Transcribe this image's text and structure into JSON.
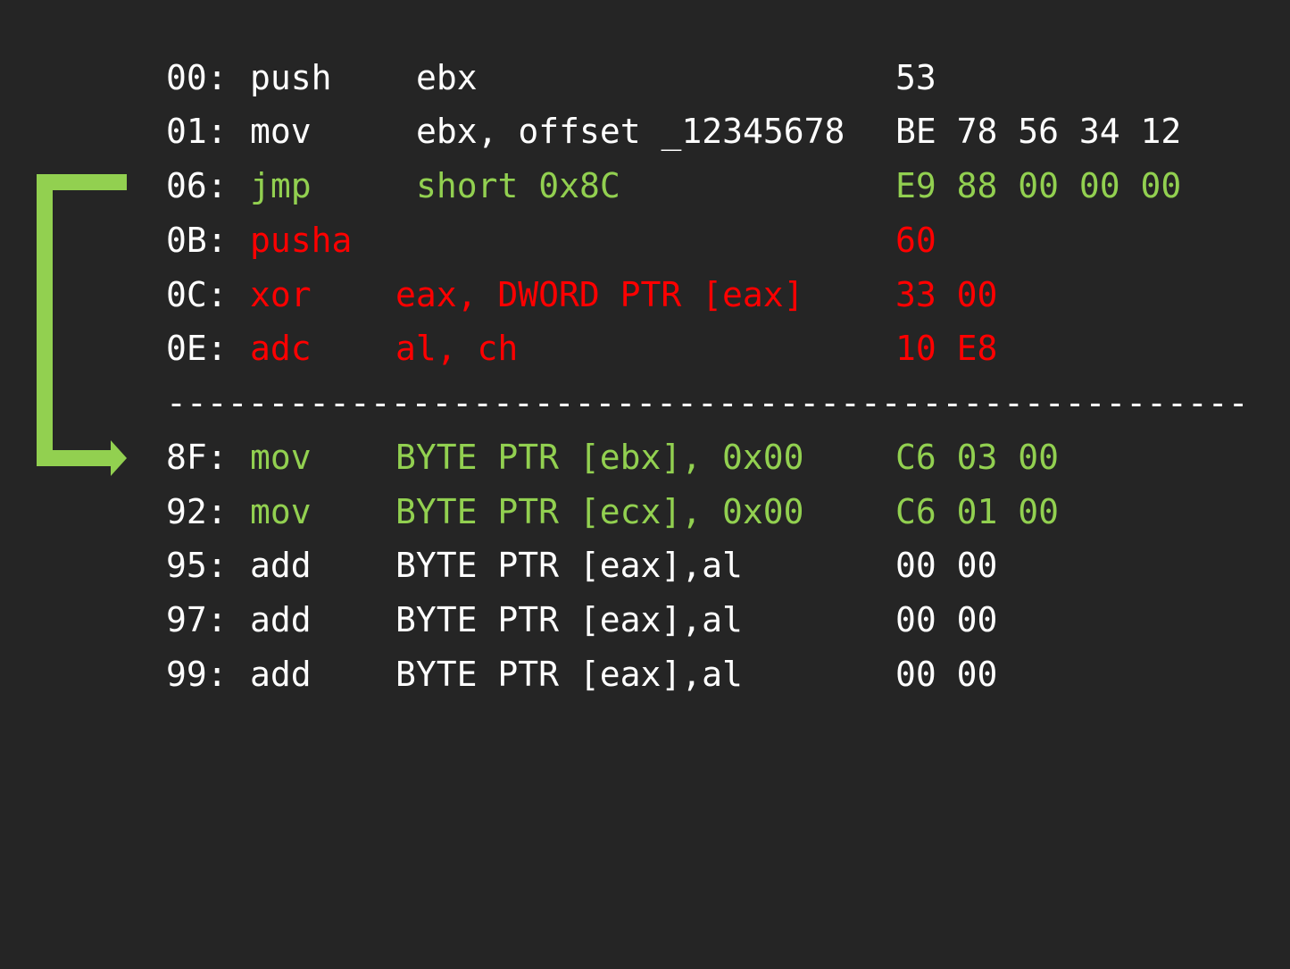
{
  "colors": {
    "background": "#252525",
    "normal": "#ffffff",
    "jump_path": "#92d050",
    "junk": "#ff0000"
  },
  "before_rows": [
    {
      "addr": "00:",
      "mnem": "push",
      "ops": "ebx",
      "bytes": "53",
      "color": "white"
    },
    {
      "addr": "01:",
      "mnem": "mov",
      "ops": "ebx, offset _12345678",
      "bytes": "BE 78 56 34 12",
      "color": "white"
    },
    {
      "addr": "06:",
      "mnem": "jmp",
      "ops": "short 0x8C",
      "bytes": "E9 88 00 00 00",
      "color": "green"
    },
    {
      "addr": "0B:",
      "mnem": "pusha",
      "ops": "",
      "bytes": "60",
      "color": "red"
    },
    {
      "addr": "0C:",
      "mnem": "xor",
      "ops": "eax, DWORD PTR [eax]",
      "bytes": "33 00",
      "color": "red"
    },
    {
      "addr": "0E:",
      "mnem": "adc",
      "ops": "al, ch",
      "bytes": "10 E8",
      "color": "red"
    }
  ],
  "separator": "--------------------------------------------------------",
  "after_rows": [
    {
      "addr": "8F:",
      "mnem": "mov",
      "ops": "BYTE PTR [ebx], 0x00",
      "bytes": "C6 03 00",
      "color": "green"
    },
    {
      "addr": "92:",
      "mnem": "mov",
      "ops": "BYTE PTR [ecx], 0x00",
      "bytes": "C6 01 00",
      "color": "green"
    },
    {
      "addr": "95:",
      "mnem": "add",
      "ops": "BYTE PTR [eax],al",
      "bytes": "00 00",
      "color": "white"
    },
    {
      "addr": "97:",
      "mnem": "add",
      "ops": "BYTE PTR [eax],al",
      "bytes": "00 00",
      "color": "white"
    },
    {
      "addr": "99:",
      "mnem": "add",
      "ops": "BYTE PTR [eax],al",
      "bytes": "00 00",
      "color": "white"
    }
  ]
}
